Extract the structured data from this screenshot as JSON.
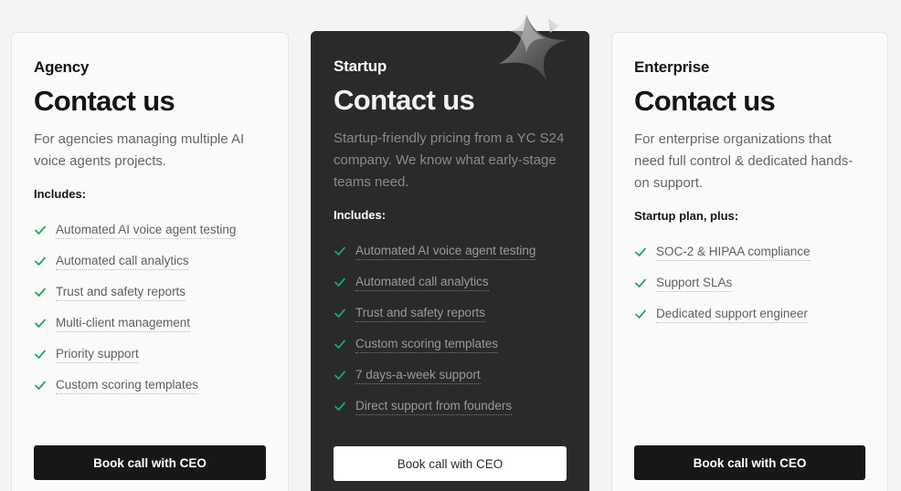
{
  "plans": [
    {
      "tier": "Agency",
      "price": "Contact us",
      "description": "For agencies managing multiple AI voice agents projects.",
      "includes_label": "Includes:",
      "features": [
        "Automated AI voice agent testing",
        "Automated call analytics",
        "Trust and safety reports",
        "Multi-client management",
        "Priority support",
        "Custom scoring templates"
      ],
      "cta": "Book call with CEO"
    },
    {
      "tier": "Startup",
      "price": "Contact us",
      "description": "Startup-friendly pricing from a YC S24 company. We know what early-stage teams need.",
      "includes_label": "Includes:",
      "features": [
        "Automated AI voice agent testing",
        "Automated call analytics",
        "Trust and safety reports",
        "Custom scoring templates",
        "7 days-a-week support",
        "Direct support from founders"
      ],
      "cta": "Book call with CEO"
    },
    {
      "tier": "Enterprise",
      "price": "Contact us",
      "description": "For enterprise organizations that need full control & dedicated hands-on support.",
      "includes_label": "Startup plan, plus:",
      "features": [
        "SOC-2 & HIPAA compliance",
        "Support SLAs",
        "Dedicated support engineer"
      ],
      "cta": "Book call with CEO"
    }
  ],
  "colors": {
    "check_green": "#1aa862",
    "dark_card": "#2a2a2b",
    "button_dark": "#17171a"
  },
  "icons": {
    "feature_check": "check-icon",
    "featured_badge": "star-icon"
  }
}
